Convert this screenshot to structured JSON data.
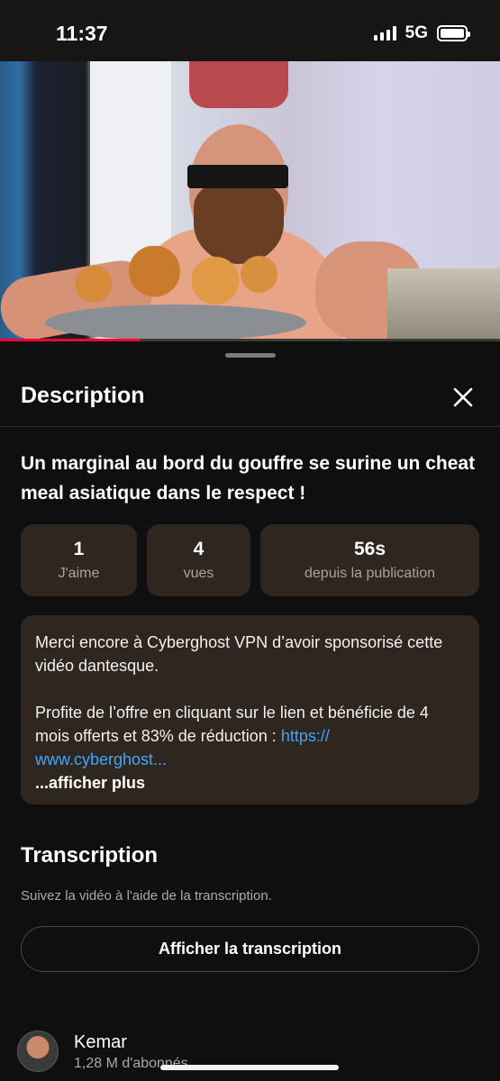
{
  "status_bar": {
    "time": "11:37",
    "network": "5G"
  },
  "video": {
    "progress_fraction": 0.28
  },
  "sheet": {
    "title": "Description",
    "video_title": "Un marginal au bord du gouffre se surine un cheat meal asiatique dans le respect !",
    "stats": {
      "likes": {
        "value": "1",
        "label": "J'aime"
      },
      "views": {
        "value": "4",
        "label": "vues"
      },
      "age": {
        "value": "56s",
        "label": "depuis la publication"
      }
    },
    "description": {
      "line1": "Merci encore à Cyberghost VPN d’avoir sponsorisé cette vidéo dantesque.",
      "line2": "Profite de l’offre en cliquant sur le lien et bénéficie de 4 mois offerts et 83% de réduction :",
      "link": "https:// www.cyberghost...",
      "more": "...afficher plus"
    },
    "transcription": {
      "title": "Transcription",
      "subtitle": "Suivez la vidéo à l'aide de la transcription.",
      "button": "Afficher la transcription"
    },
    "channel": {
      "name": "Kemar",
      "subscribers": "1,28 M d'abonnés"
    }
  },
  "colors": {
    "accent_red": "#ff0033",
    "link_blue": "#3ea6ff",
    "card_bg": "#2f2620"
  },
  "icons": {
    "close": "close-icon"
  }
}
